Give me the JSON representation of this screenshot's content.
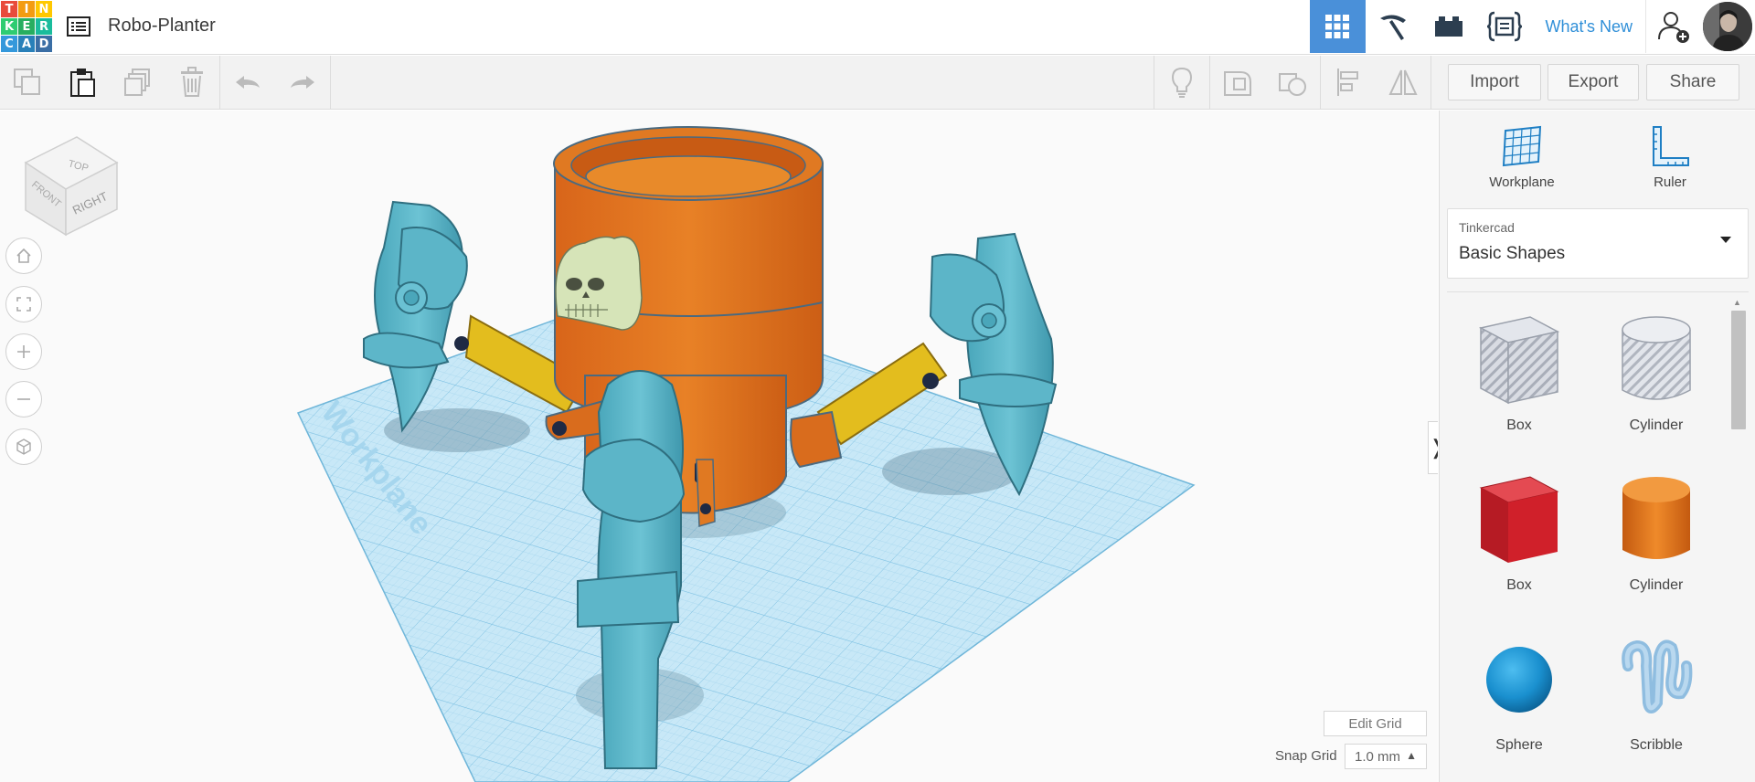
{
  "logo": {
    "letters": [
      "T",
      "I",
      "N",
      "K",
      "E",
      "R",
      "C",
      "A",
      "D"
    ],
    "colors": [
      "#e84b3c",
      "#f39c12",
      "#ffc800",
      "#2ecc71",
      "#27ae60",
      "#1abc9c",
      "#3498db",
      "#2980b9",
      "#3a6ea5"
    ]
  },
  "header": {
    "title": "Robo-Planter",
    "whats_new": "What's New",
    "active_color": "#4a90d9"
  },
  "toolbar": {
    "import_label": "Import",
    "export_label": "Export",
    "share_label": "Share"
  },
  "viewcube": {
    "top": "TOP",
    "front": "FRONT",
    "right": "RIGHT"
  },
  "workplane_label": "Workplane",
  "grid": {
    "edit_label": "Edit Grid",
    "snap_label": "Snap Grid",
    "snap_value": "1.0 mm"
  },
  "panel": {
    "tools": [
      {
        "label": "Workplane",
        "icon": "workplane-grid-icon"
      },
      {
        "label": "Ruler",
        "icon": "ruler-icon"
      }
    ],
    "library": {
      "category": "Tinkercad",
      "name": "Basic Shapes"
    },
    "shapes": [
      {
        "label": "Box",
        "icon": "box-hole-icon"
      },
      {
        "label": "Cylinder",
        "icon": "cylinder-hole-icon"
      },
      {
        "label": "Box",
        "icon": "box-solid-icon",
        "color": "#d0202a"
      },
      {
        "label": "Cylinder",
        "icon": "cylinder-solid-icon",
        "color": "#e0751a"
      },
      {
        "label": "Sphere",
        "icon": "sphere-icon",
        "color": "#1a90cf"
      },
      {
        "label": "Scribble",
        "icon": "scribble-icon",
        "color": "#8fbde0"
      }
    ]
  },
  "model": {
    "body_color": "#e0761f",
    "leg_color": "#5ab5c8",
    "joint_color": "#e5c21e",
    "skull_color": "#d6e4b8",
    "plane_color": "#bfe3f5"
  }
}
